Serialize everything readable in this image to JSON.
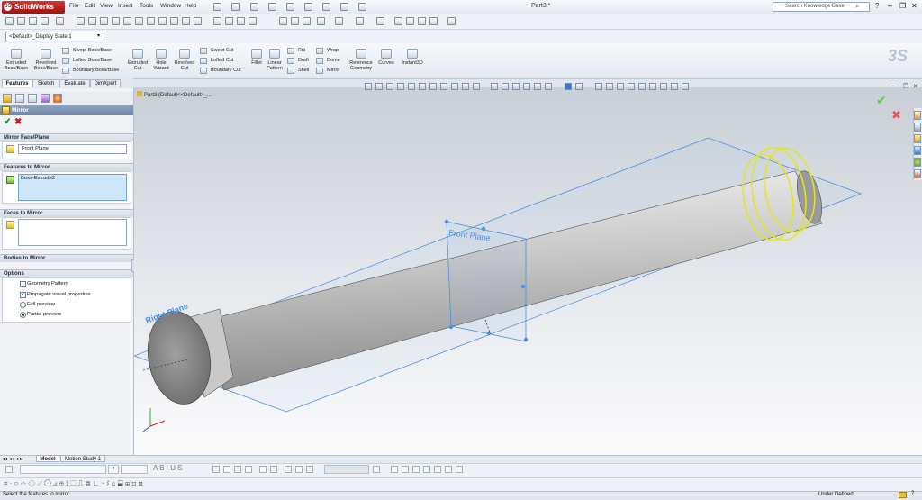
{
  "app": {
    "logo_text": "SolidWorks",
    "doc_title": "Part3 *"
  },
  "menu": [
    "File",
    "Edit",
    "View",
    "Insert",
    "Tools",
    "Window",
    "Help"
  ],
  "search": {
    "placeholder": "Search Knowledge Base"
  },
  "config": {
    "selected": "<Default>_Display State 1"
  },
  "commands": {
    "extruded_boss": "Extruded Boss/Base",
    "revolved_boss": "Revolved Boss/Base",
    "swept_boss": "Swept Boss/Base",
    "lofted_boss": "Lofted Boss/Base",
    "boundary_boss": "Boundary Boss/Base",
    "extruded_cut": "Extruded Cut",
    "hole_wizard": "Hole Wizard",
    "revolved_cut": "Revolved Cut",
    "swept_cut": "Swept Cut",
    "lofted_cut": "Lofted Cut",
    "boundary_cut": "Boundary Cut",
    "fillet": "Fillet",
    "linear_pattern": "Linear Pattern",
    "rib": "Rib",
    "draft": "Draft",
    "shell": "Shell",
    "wrap": "Wrap",
    "dome": "Dome",
    "mirror": "Mirror",
    "reference_geometry": "Reference Geometry",
    "curves": "Curves",
    "instant3d": "Instant3D"
  },
  "tabs": [
    "Features",
    "Sketch",
    "Evaluate",
    "DimXpert"
  ],
  "property_manager": {
    "title": "Mirror",
    "ok": "✔",
    "cancel": "✖",
    "mirror_face_label": "Mirror Face/Plane",
    "mirror_face_value": "Front Plane",
    "features_label": "Features to Mirror",
    "features_value": "Boss-Extrude2",
    "faces_label": "Faces to Mirror",
    "bodies_label": "Bodies to Mirror",
    "options_label": "Options",
    "geometry_pattern": "Geometry Pattern",
    "geometry_pattern_checked": false,
    "propagate": "Propagate visual properties",
    "propagate_checked": true,
    "full_preview": "Full preview",
    "partial_preview": "Partial preview",
    "preview_selected": "Partial preview"
  },
  "viewport": {
    "tree_root": "Part3  (Default<<Default>_...",
    "front_plane_label": "Front Plane",
    "right_plane_label": "Right Plane"
  },
  "colors": {
    "accent_red": "#c81d1d",
    "ok_green": "#1f9a2a",
    "plane_blue": "#4a90e2",
    "preview_yellow": "#e3e61a"
  },
  "bottom_tabs": [
    "Model",
    "Motion Study 1"
  ],
  "status": {
    "left": "Select the features to mirror",
    "right": "Under Defined"
  }
}
